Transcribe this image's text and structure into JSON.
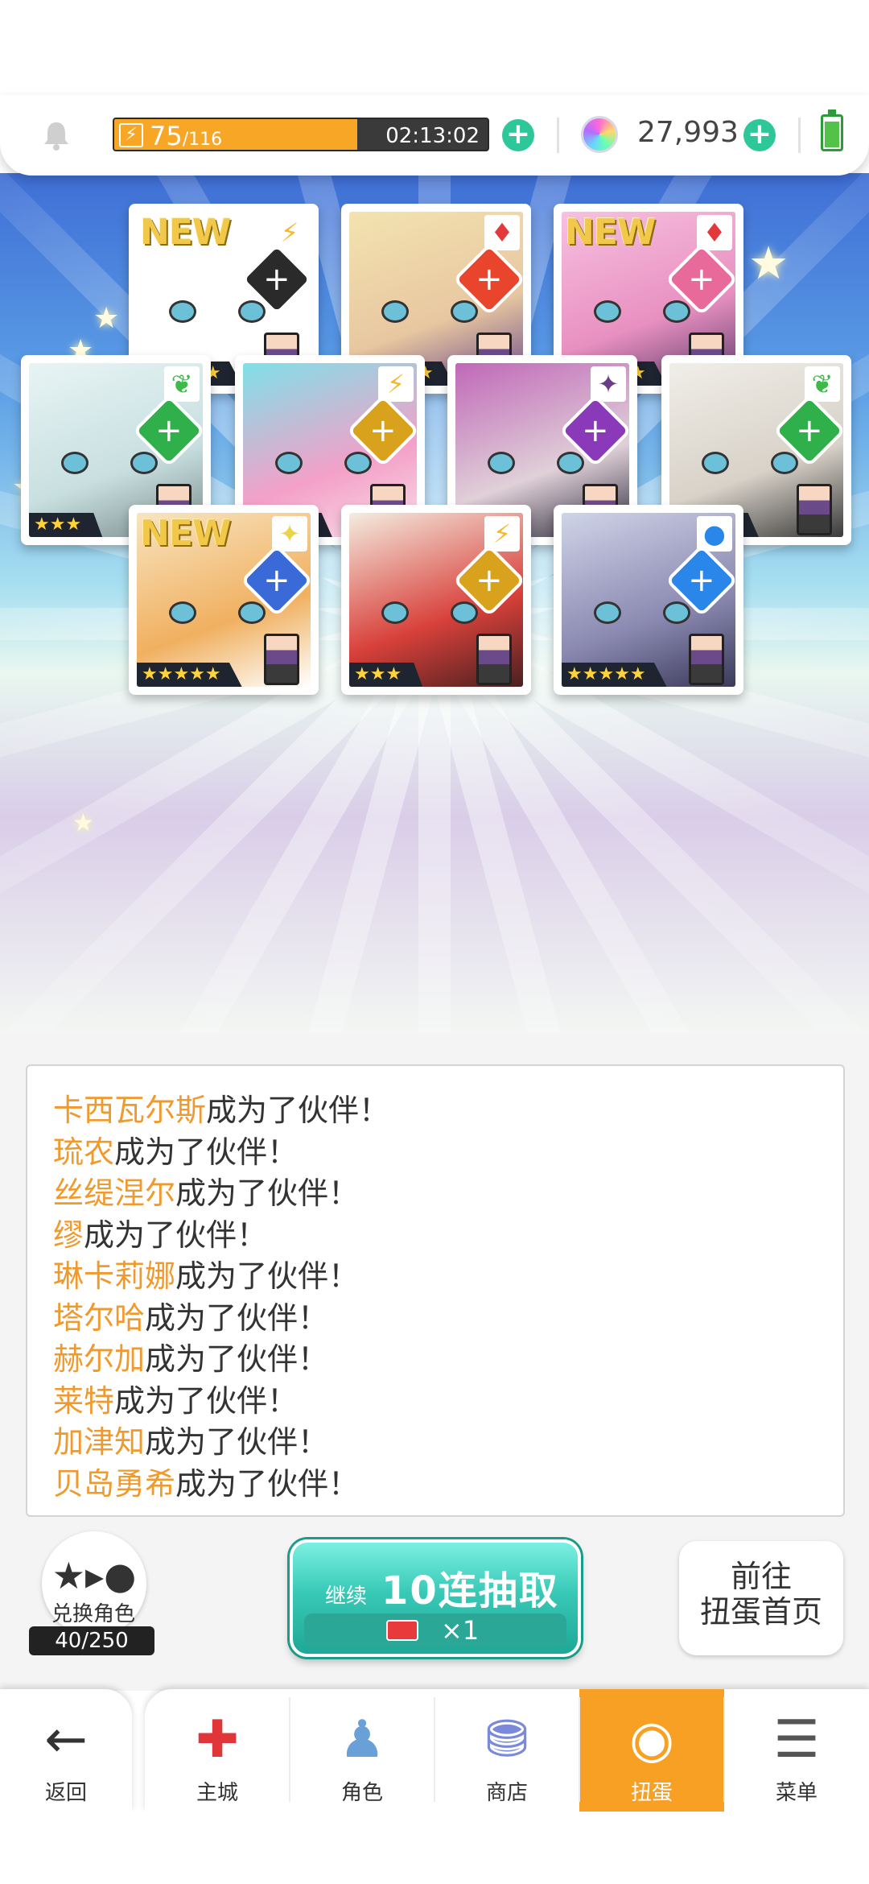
{
  "header": {
    "stamina_current": "75",
    "stamina_max": "/116",
    "stamina_fill_fraction": 0.65,
    "timer": "02:13:02",
    "gems": "27,993"
  },
  "cards": [
    {
      "new": "NEW",
      "stars": "★★★★★",
      "element": "⚡",
      "element_color": "#f6b928",
      "weapon_color": "#2a2a2a"
    },
    {
      "new": "",
      "stars": "★★★★★",
      "element": "♦",
      "element_color": "#e23a3a",
      "weapon_color": "#e8452c"
    },
    {
      "new": "NEW",
      "stars": "★★★★★",
      "element": "♦",
      "element_color": "#e23a3a",
      "weapon_color": "#e86a9a"
    },
    {
      "new": "",
      "stars": "★★★",
      "element": "❦",
      "element_color": "#3dba4a",
      "weapon_color": "#2fb04a"
    },
    {
      "new": "",
      "stars": "★★★★",
      "element": "⚡",
      "element_color": "#f6b928",
      "weapon_color": "#d9a21c"
    },
    {
      "new": "",
      "stars": "★★★",
      "element": "✦",
      "element_color": "#6a3d8a",
      "weapon_color": "#8a3ab8"
    },
    {
      "new": "",
      "stars": "★★★★",
      "element": "❦",
      "element_color": "#3dba4a",
      "weapon_color": "#2fb04a"
    },
    {
      "new": "NEW",
      "stars": "★★★★★",
      "element": "✦",
      "element_color": "#e8d64a",
      "weapon_color": "#3a6ad8"
    },
    {
      "new": "",
      "stars": "★★★",
      "element": "⚡",
      "element_color": "#f6b928",
      "weapon_color": "#d9a21c"
    },
    {
      "new": "",
      "stars": "★★★★★",
      "element": "●",
      "element_color": "#2a86e8",
      "weapon_color": "#2a86e8"
    }
  ],
  "log": [
    {
      "name": "卡西瓦尔斯",
      "text": "成为了伙伴！"
    },
    {
      "name": "琉农",
      "text": "成为了伙伴！"
    },
    {
      "name": "丝缇涅尔",
      "text": "成为了伙伴！"
    },
    {
      "name": "缪",
      "text": "成为了伙伴！"
    },
    {
      "name": "琳卡莉娜",
      "text": "成为了伙伴！"
    },
    {
      "name": "塔尔哈",
      "text": "成为了伙伴！"
    },
    {
      "name": "赫尔加",
      "text": "成为了伙伴！"
    },
    {
      "name": "莱特",
      "text": "成为了伙伴！"
    },
    {
      "name": "加津知",
      "text": "成为了伙伴！"
    },
    {
      "name": "贝岛勇希",
      "text": "成为了伙伴！"
    }
  ],
  "actions": {
    "exchange_label": "兑换角色",
    "exchange_count": "40/250",
    "pull_continue": "继续",
    "pull_label": "10连抽取",
    "pull_cost": "×1",
    "home_line1": "前往",
    "home_line2": "扭蛋首页"
  },
  "nav": {
    "back": "返回",
    "items": [
      "主城",
      "角色",
      "商店",
      "扭蛋",
      "菜单"
    ],
    "active_index": 3
  },
  "colors": {
    "accent_orange": "#f8a023",
    "name_orange": "#f09a2d",
    "teal_button": "#38c9b6"
  }
}
